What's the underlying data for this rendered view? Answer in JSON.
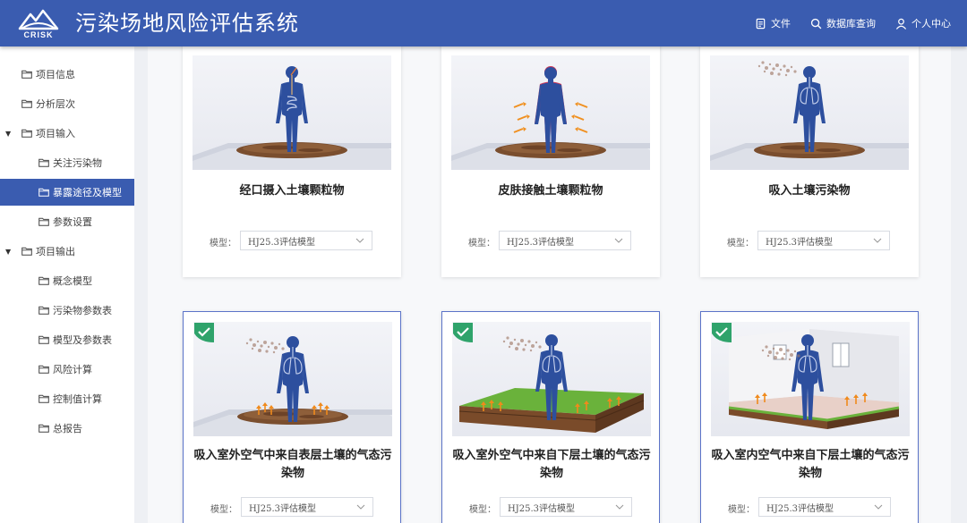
{
  "header": {
    "logo_text": "CRISK",
    "title": "污染场地风险评估系统",
    "nav": [
      {
        "label": "文件",
        "icon": "document-icon"
      },
      {
        "label": "数据库查询",
        "icon": "search-icon"
      },
      {
        "label": "个人中心",
        "icon": "user-icon"
      }
    ]
  },
  "sidebar": {
    "items": [
      {
        "label": "项目信息",
        "level": 0,
        "expanded": null,
        "active": false
      },
      {
        "label": "分析层次",
        "level": 0,
        "expanded": null,
        "active": false
      },
      {
        "label": "项目输入",
        "level": 0,
        "expanded": true,
        "active": false
      },
      {
        "label": "关注污染物",
        "level": 1,
        "expanded": null,
        "active": false
      },
      {
        "label": "暴露途径及模型",
        "level": 1,
        "expanded": null,
        "active": true
      },
      {
        "label": "参数设置",
        "level": 1,
        "expanded": null,
        "active": false
      },
      {
        "label": "项目输出",
        "level": 0,
        "expanded": true,
        "active": false
      },
      {
        "label": "概念模型",
        "level": 1,
        "expanded": null,
        "active": false
      },
      {
        "label": "污染物参数表",
        "level": 1,
        "expanded": null,
        "active": false
      },
      {
        "label": "模型及参数表",
        "level": 1,
        "expanded": null,
        "active": false
      },
      {
        "label": "风险计算",
        "level": 1,
        "expanded": null,
        "active": false
      },
      {
        "label": "控制值计算",
        "level": 1,
        "expanded": null,
        "active": false
      },
      {
        "label": "总报告",
        "level": 1,
        "expanded": null,
        "active": false
      }
    ]
  },
  "cards": [
    {
      "title": "经口摄入土壤颗粒物",
      "model_label": "模型：",
      "model_value": "HJ25.3评估模型",
      "selected": false
    },
    {
      "title": "皮肤接触土壤颗粒物",
      "model_label": "模型：",
      "model_value": "HJ25.3评估模型",
      "selected": false
    },
    {
      "title": "吸入土壤污染物",
      "model_label": "模型：",
      "model_value": "HJ25.3评估模型",
      "selected": false
    },
    {
      "title": "吸入室外空气中来自表层土壤的气态污染物",
      "model_label": "模型：",
      "model_value": "HJ25.3评估模型",
      "selected": true
    },
    {
      "title": "吸入室外空气中来自下层土壤的气态污染物",
      "model_label": "模型：",
      "model_value": "HJ25.3评估模型",
      "selected": true
    },
    {
      "title": "吸入室内空气中来自下层土壤的气态污染物",
      "model_label": "模型：",
      "model_value": "HJ25.3评估模型",
      "selected": true
    }
  ],
  "colors": {
    "primary": "#3a5cb0",
    "check": "#2fa36b",
    "body": "#2d4f9e"
  }
}
